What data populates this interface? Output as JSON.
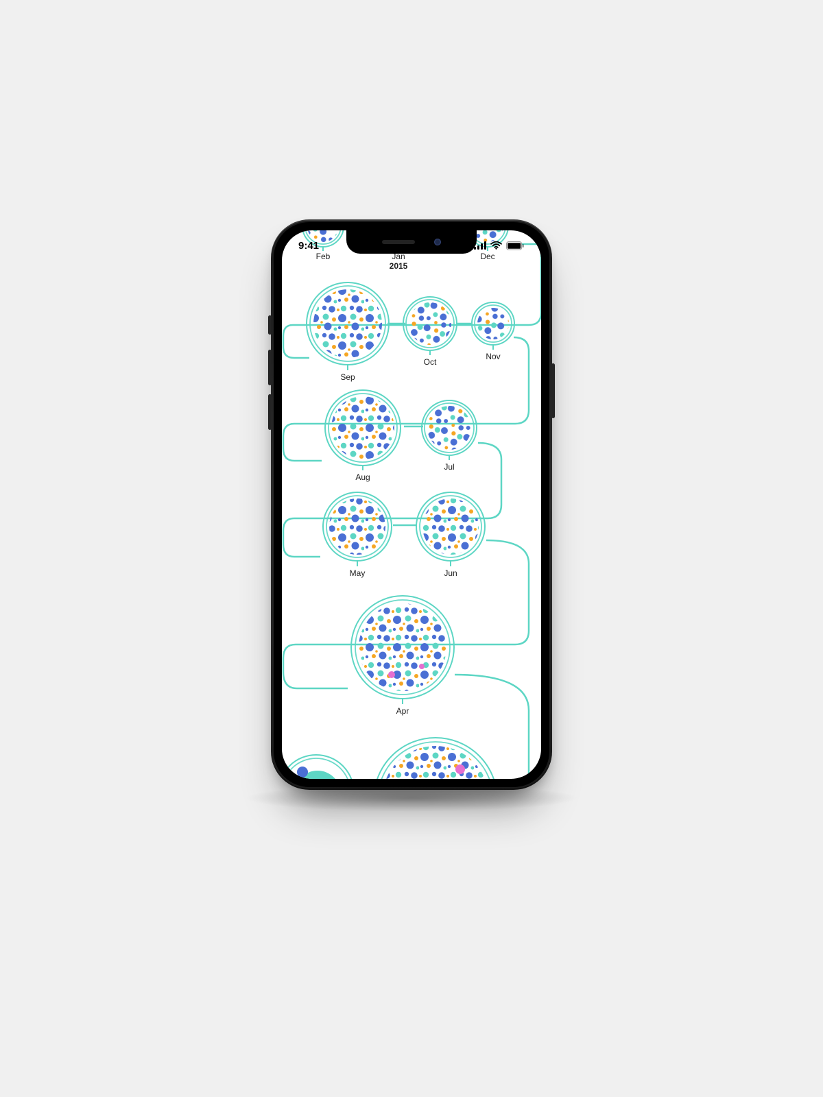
{
  "status_bar": {
    "time": "9:41",
    "signal_bars": 4,
    "wifi_bars": 3,
    "battery_pct": 95
  },
  "timeline": {
    "year_label": "2015",
    "accent_color": "#5dd6c4",
    "palette": {
      "primary": "#4a6fd4",
      "secondary": "#5dd6c4",
      "tertiary": "#f5a623",
      "quaternary": "#e56fd0"
    },
    "nodes": [
      {
        "id": "feb",
        "label": "Feb",
        "visible": "partial-top",
        "size": 60
      },
      {
        "id": "jan",
        "label": "Jan",
        "visible": "partial-top",
        "size": 60,
        "year_anchor": true
      },
      {
        "id": "dec",
        "label": "Dec",
        "visible": "partial-top",
        "size": 60
      },
      {
        "id": "sep",
        "label": "Sep",
        "size": 120
      },
      {
        "id": "oct",
        "label": "Oct",
        "size": 78
      },
      {
        "id": "nov",
        "label": "Nov",
        "size": 62
      },
      {
        "id": "aug",
        "label": "Aug",
        "size": 110
      },
      {
        "id": "jul",
        "label": "Jul",
        "size": 80
      },
      {
        "id": "may",
        "label": "May",
        "size": 100
      },
      {
        "id": "jun",
        "label": "Jun",
        "size": 100
      },
      {
        "id": "apr",
        "label": "Apr",
        "size": 150
      },
      {
        "id": "mar",
        "label": "",
        "visible": "partial-bottom",
        "size": 160
      },
      {
        "id": "mar2",
        "label": "",
        "visible": "partial-bottom",
        "size": 90
      }
    ]
  }
}
